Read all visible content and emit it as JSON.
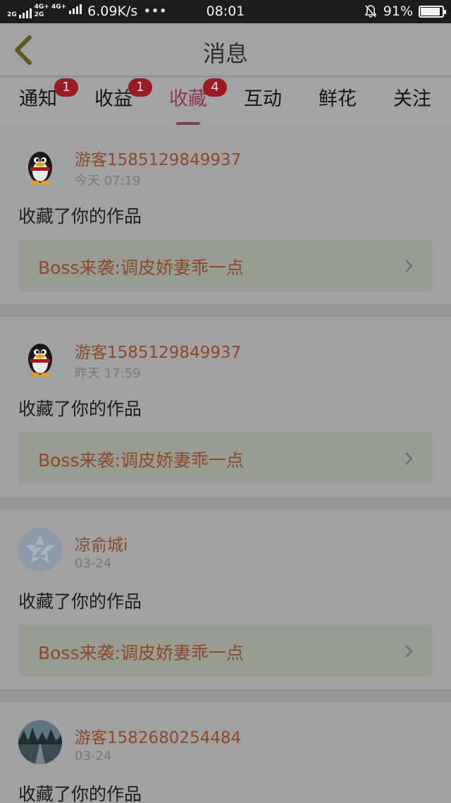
{
  "status_bar": {
    "network_top": "2G",
    "network_mid": "4G+ 4G+",
    "network_bottom": "2G",
    "speed": "6.09K/s",
    "dots": "•••",
    "time": "08:01",
    "battery": "91%",
    "battery_level": 0.91
  },
  "header": {
    "title": "消息",
    "back_icon": "chevron-left-icon"
  },
  "tabs": [
    {
      "label": "通知",
      "badge": "1"
    },
    {
      "label": "收益",
      "badge": "1"
    },
    {
      "label": "收藏",
      "badge": "4",
      "active": true
    },
    {
      "label": "互动"
    },
    {
      "label": "鲜花"
    },
    {
      "label": "关注"
    }
  ],
  "items": [
    {
      "user": "游客1585129849937",
      "time": "今天 07:19",
      "action": "收藏了你的作品",
      "work": "Boss来袭:调皮娇妻乖一点",
      "avatar": "penguin-avatar"
    },
    {
      "user": "游客1585129849937",
      "time": "昨天 17:59",
      "action": "收藏了你的作品",
      "work": "Boss来袭:调皮娇妻乖一点",
      "avatar": "penguin-avatar"
    },
    {
      "user": "凉俞城i",
      "time": "03-24",
      "action": "收藏了你的作品",
      "work": "Boss来袭:调皮娇妻乖一点",
      "avatar": "default-star-avatar"
    },
    {
      "user": "游客1582680254484",
      "time": "03-24",
      "action": "收藏了你的作品",
      "work": "",
      "avatar": "landscape-photo-avatar"
    }
  ],
  "colors": {
    "accent": "#8a3a55",
    "badge": "#9a1c22",
    "username": "#8a4a2a"
  }
}
